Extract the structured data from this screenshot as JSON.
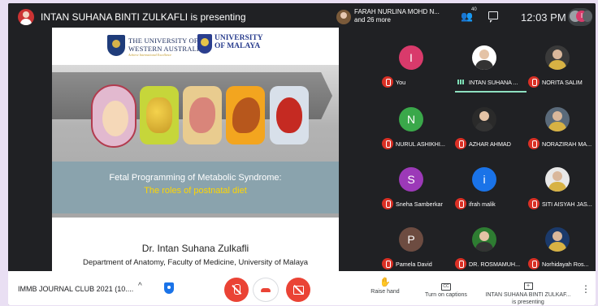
{
  "presenter_banner": "INTAN SUHANA BINTI ZULKAFLI is presenting",
  "others": {
    "line1": "FARAH NURLINA MOHD N...",
    "line2": "and 26 more"
  },
  "people_count": "40",
  "clock": "12:03 PM",
  "self_pill": "I",
  "slide": {
    "uwa_name_1": "THE UNIVERSITY OF",
    "uwa_name_2": "WESTERN AUSTRALIA",
    "uwa_motto": "Achieve International Excellence",
    "um_name_1": "UNIVERSITY",
    "um_name_2": "OF MALAYA",
    "title": "Fetal Programming of Metabolic Syndrome:",
    "subtitle": "The roles of postnatal diet",
    "author": "Dr. Intan Suhana Zulkafli",
    "department": "Department of Anatomy, Faculty of Medicine, University of Malaya"
  },
  "participants": [
    {
      "name": "You",
      "avatar_letter": "I",
      "color": "#d93a6b"
    },
    {
      "name": "INTAN SUHANA ...",
      "avatar_letter": "",
      "color": "#ffffff"
    },
    {
      "name": "NORITA SALIM",
      "avatar_letter": "",
      "color": "#3a3a3a"
    },
    {
      "name": "NURUL ASHIKHI...",
      "avatar_letter": "N",
      "color": "#3aa84a"
    },
    {
      "name": "AZHAR AHMAD",
      "avatar_letter": "",
      "color": "#2a2a2a"
    },
    {
      "name": "NORAZIRAH MA...",
      "avatar_letter": "",
      "color": "#5a6a7a"
    },
    {
      "name": "Sneha Samberkar",
      "avatar_letter": "S",
      "color": "#9c39b8"
    },
    {
      "name": "ifrah malik",
      "avatar_letter": "i",
      "color": "#1a73e8"
    },
    {
      "name": "SITI AISYAH JAS...",
      "avatar_letter": "",
      "color": "#e8e8e8"
    },
    {
      "name": "Pamela David",
      "avatar_letter": "P",
      "color": "#6d4c41"
    },
    {
      "name": "DR. ROSMAMUH...",
      "avatar_letter": "",
      "color": "#2e7d32"
    },
    {
      "name": "Norhidayah Ros...",
      "avatar_letter": "",
      "color": "#1b3a6b"
    }
  ],
  "bottom": {
    "meeting_name": "IMMB JOURNAL CLUB 2021 (10....",
    "caret": "^",
    "raise_hand": "Raise hand",
    "captions_icon": "CC",
    "turn_on_captions": "Turn on captions",
    "present_line1": "INTAN SUHANA BINTI ZULKAF...",
    "present_line2": "is presenting",
    "more": "⋮"
  },
  "icons": {
    "people": "people-icon",
    "chat": "chat-icon",
    "mic_off": "mic-off-icon",
    "hangup": "hangup-icon",
    "camera_off": "camera-off-icon",
    "hand": "hand-icon"
  }
}
